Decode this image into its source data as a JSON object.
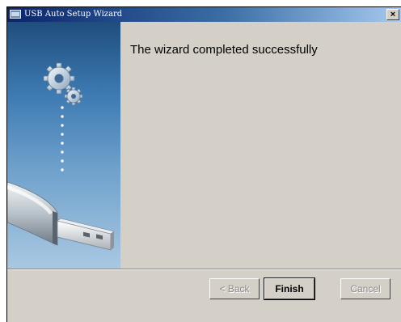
{
  "window": {
    "title": "USB Auto Setup Wizard",
    "close_glyph": "×"
  },
  "content": {
    "heading": "The wizard completed successfully"
  },
  "buttons": {
    "back": "< Back",
    "finish": "Finish",
    "cancel": "Cancel"
  },
  "icons": {
    "app": "usb-app-icon",
    "gears": "gears-icon",
    "usb_drive": "usb-drive-icon"
  }
}
